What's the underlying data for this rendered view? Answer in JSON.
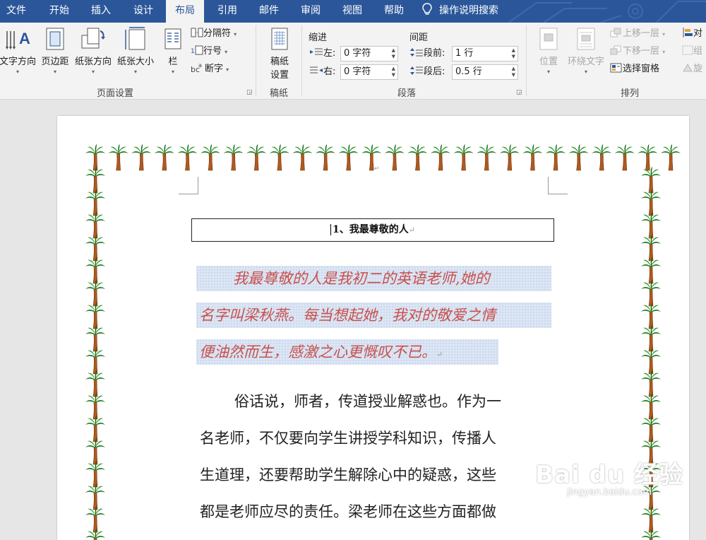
{
  "tabs": [
    {
      "label": "文件",
      "active": false
    },
    {
      "label": "开始",
      "active": false
    },
    {
      "label": "插入",
      "active": false
    },
    {
      "label": "设计",
      "active": false
    },
    {
      "label": "布局",
      "active": true
    },
    {
      "label": "引用",
      "active": false
    },
    {
      "label": "邮件",
      "active": false
    },
    {
      "label": "审阅",
      "active": false
    },
    {
      "label": "视图",
      "active": false
    },
    {
      "label": "帮助",
      "active": false
    }
  ],
  "tell_me": {
    "label": "操作说明搜索",
    "icon": "lightbulb-icon"
  },
  "colors": {
    "ribbon_blue": "#2b579a",
    "highlight_text": "#c8504b",
    "highlight_bg": "#dce6f4"
  },
  "page_setup": {
    "text_direction": "文字方向",
    "margins": "页边距",
    "orientation": "纸张方向",
    "size": "纸张大小",
    "columns": "栏",
    "breaks": "分隔符",
    "line_numbers": "行号",
    "hyphenation": "断字",
    "group_label": "页面设置"
  },
  "manuscript": {
    "button": "稿纸设置",
    "line1": "稿纸",
    "line2": "设置",
    "group_label": "稿纸"
  },
  "paragraph": {
    "indent_header": "缩进",
    "spacing_header": "间距",
    "left_label": "左:",
    "right_label": "右:",
    "before_label": "段前:",
    "after_label": "段后:",
    "left_value": "0 字符",
    "right_value": "0 字符",
    "before_value": "1 行",
    "after_value": "0.5 行",
    "group_label": "段落"
  },
  "arrange": {
    "position": "位置",
    "wrap_text": "环绕文字",
    "bring_forward": "上移一层",
    "send_backward": "下移一层",
    "selection_pane": "选择窗格",
    "align": "对",
    "group": "组",
    "rotate": "旋",
    "group_label": "排列"
  },
  "document": {
    "title": "1、我最尊敬的人",
    "highlighted_lines": [
      "我最尊敬的人是我初二的英语老师,她的",
      "名字叫梁秋燕。每当想起她，我对的敬爱之情",
      "便油然而生，感激之心更慨叹不已。"
    ],
    "body_lines": [
      "俗话说，师者，传道授业解惑也。作为一",
      "名老师，不仅要向学生讲授学科知识，传播人",
      "生道理，还要帮助学生解除心中的疑惑，这些",
      "都是老师应尽的责任。梁老师在这些方面都做"
    ],
    "paragraph_mark": "↵",
    "border_art": "palm-tree-icon"
  },
  "watermark": {
    "brand": "Bai du 经验",
    "url": "jingyan.baidu.com"
  }
}
